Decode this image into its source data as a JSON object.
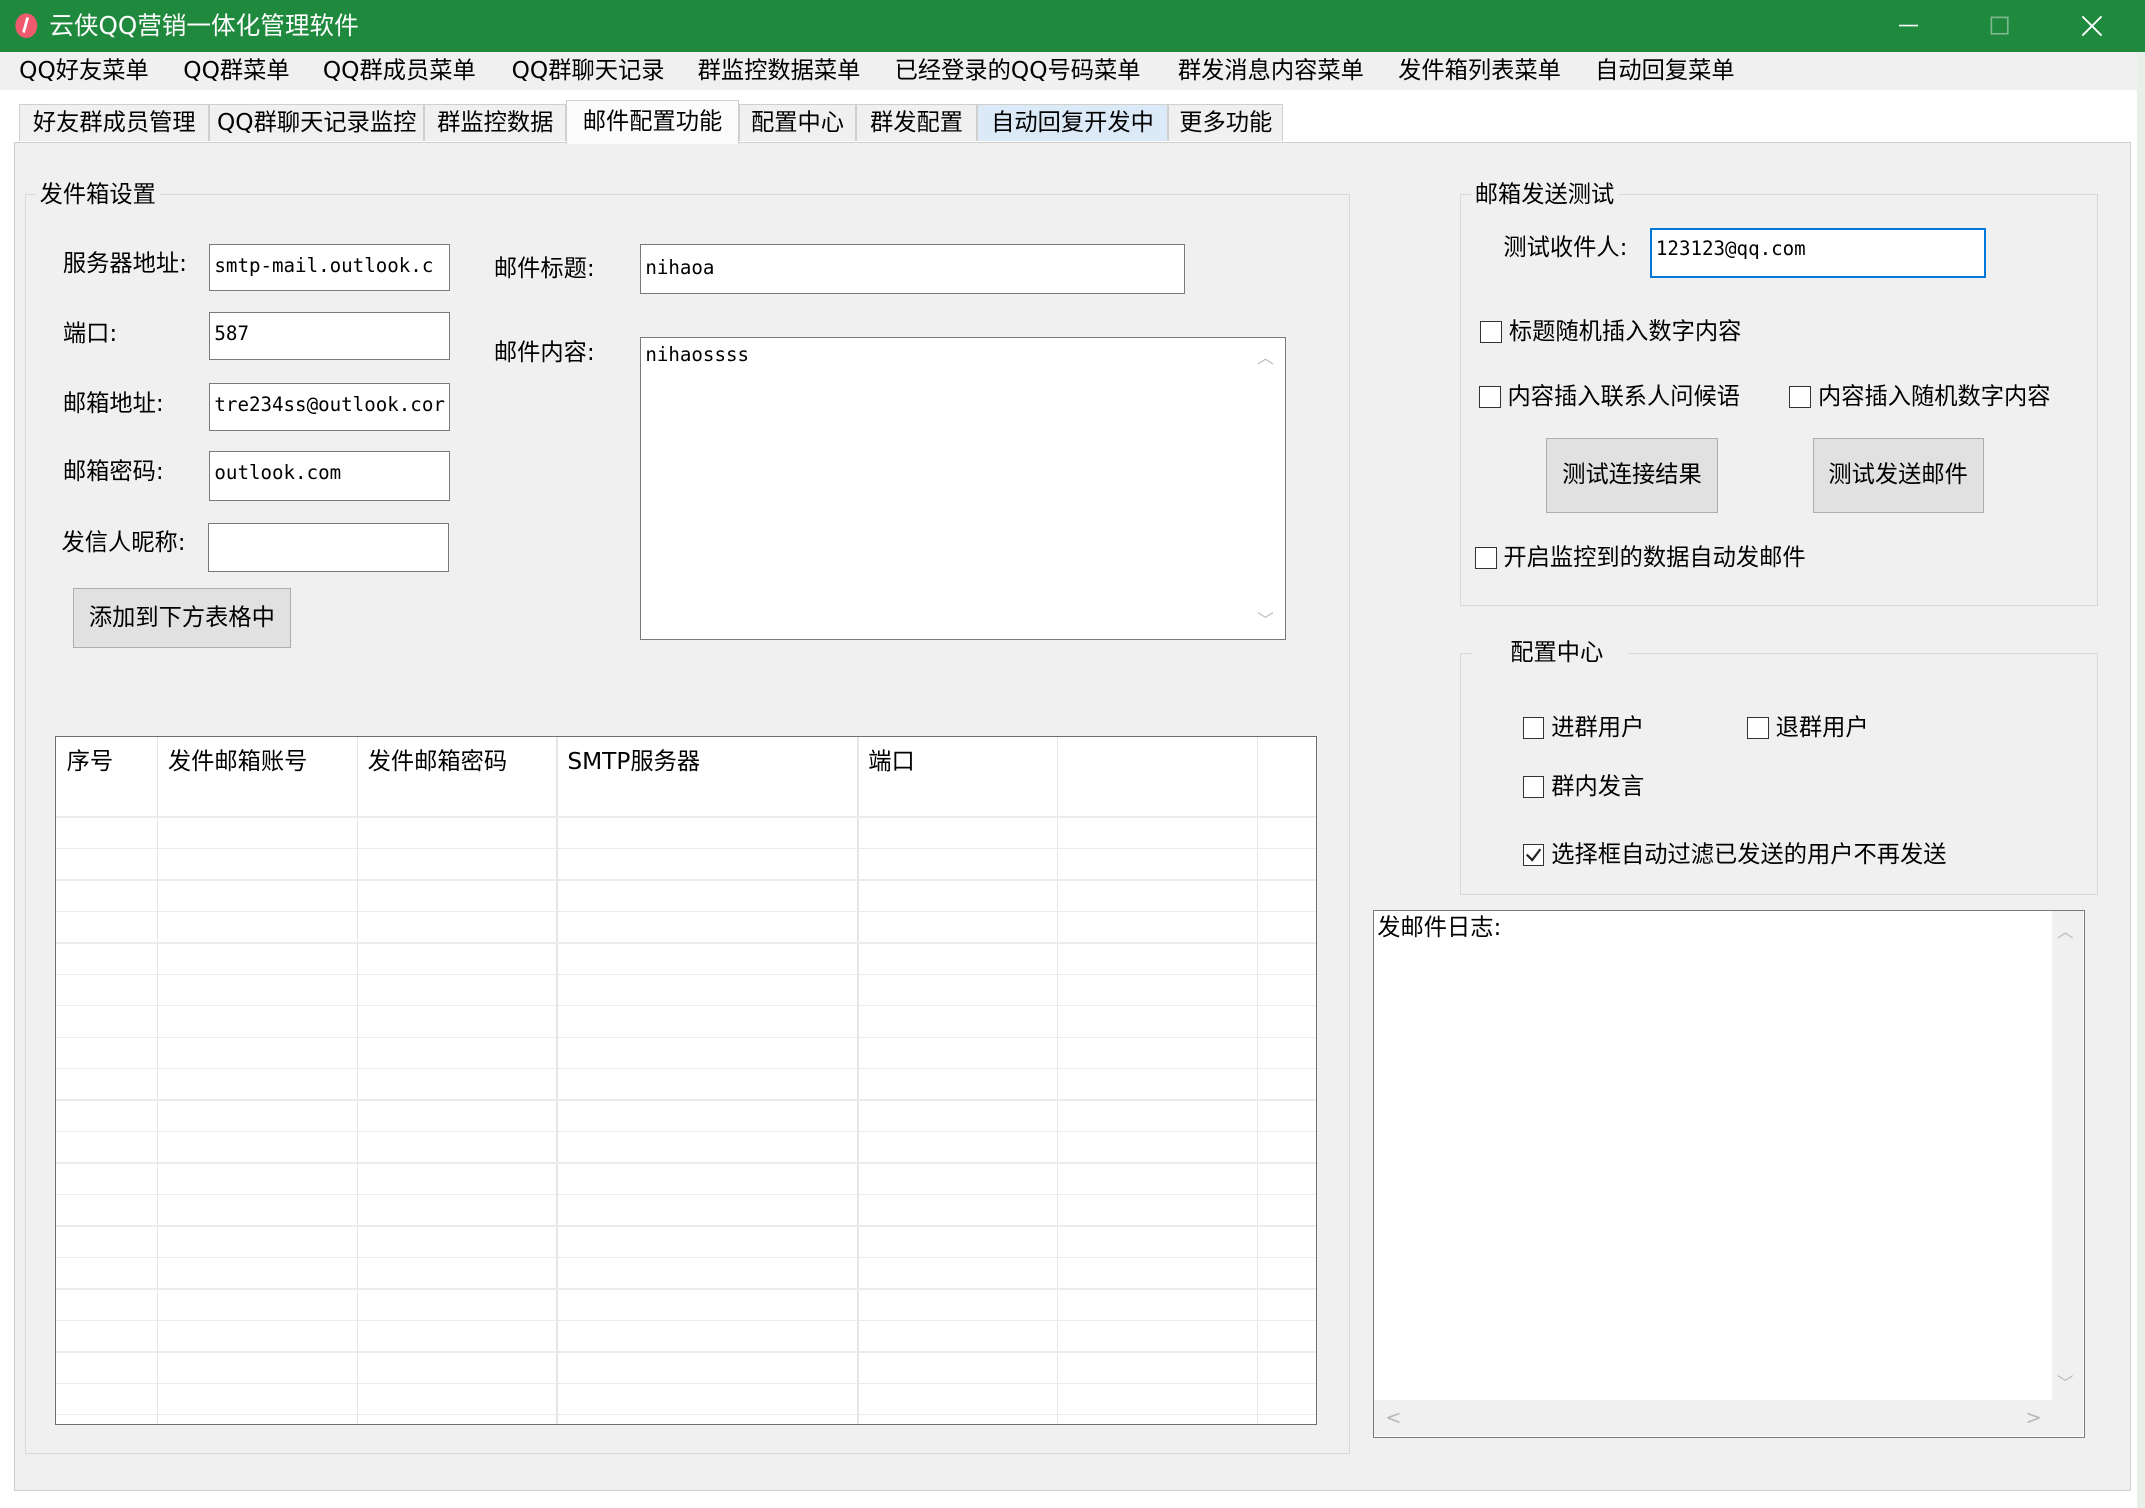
{
  "window": {
    "title": "云侠QQ营销一体化管理软件",
    "accent_color": "#1f8a3d",
    "controls": [
      "minimize-icon",
      "maximize-icon",
      "close-icon"
    ]
  },
  "menu": [
    "QQ好友菜单",
    "QQ群菜单",
    "QQ群成员菜单",
    "QQ群聊天记录",
    "群监控数据菜单",
    "已经登录的QQ号码菜单",
    "群发消息内容菜单",
    "发件箱列表菜单",
    "自动回复菜单"
  ],
  "tabs": [
    "好友群成员管理",
    "QQ群聊天记录监控",
    "群监控数据",
    "邮件配置功能",
    "配置中心",
    "群发配置",
    "自动回复开发中",
    "更多功能"
  ],
  "active_tab": "邮件配置功能",
  "sender_settings": {
    "group_title": "发件箱设置",
    "server_label": "服务器地址:",
    "server_value": "smtp-mail.outlook.c",
    "port_label": "端口:",
    "port_value": "587",
    "email_label": "邮箱地址:",
    "email_value": "tre234ss@outlook.cor",
    "password_label": "邮箱密码:",
    "password_value": "outlook.com",
    "nickname_label": "发信人昵称:",
    "nickname_value": "",
    "subject_label": "邮件标题:",
    "subject_value": "nihaoa",
    "content_label": "邮件内容:",
    "content_value": "nihaossss",
    "add_button": "添加到下方表格中"
  },
  "table": {
    "columns": [
      "序号",
      "发件邮箱账号",
      "发件邮箱密码",
      "SMTP服务器",
      "端口",
      ""
    ],
    "rows": []
  },
  "mail_test": {
    "group_title": "邮箱发送测试",
    "recipient_label": "测试收件人:",
    "recipient_value": "123123@qq.com",
    "random_number_title": {
      "label": "标题随机插入数字内容",
      "checked": false
    },
    "insert_greeting": {
      "label": "内容插入联系人问候语",
      "checked": false
    },
    "insert_random_number": {
      "label": "内容插入随机数字内容",
      "checked": false
    },
    "test_connection_button": "测试连接结果",
    "test_send_button": "测试发送邮件",
    "auto_send": {
      "label": "开启监控到的数据自动发邮件",
      "checked": false
    }
  },
  "config_center": {
    "group_title": "配置中心",
    "join_group": {
      "label": "进群用户",
      "checked": false
    },
    "leave_group": {
      "label": "退群用户",
      "checked": false
    },
    "group_speech": {
      "label": "群内发言",
      "checked": false
    },
    "filter_sent": {
      "label": "选择框自动过滤已发送的用户不再发送",
      "checked": true
    }
  },
  "log": {
    "text": "发邮件日志:"
  }
}
